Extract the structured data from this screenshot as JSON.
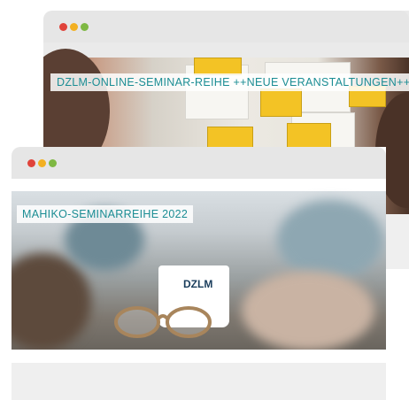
{
  "windows": {
    "back": {
      "banner_label": "DZLM-ONLINE-SEMINAR-REIHE ++NEUE VERANSTALTUNGEN++"
    },
    "front": {
      "banner_label": "MAHIKO-SEMINARREIHE 2022",
      "mug_logo": "DZLM"
    }
  },
  "colors": {
    "accent": "#1b8d94",
    "dot_red": "#e0433a",
    "dot_yellow": "#f3b022",
    "dot_green": "#7eb843"
  }
}
